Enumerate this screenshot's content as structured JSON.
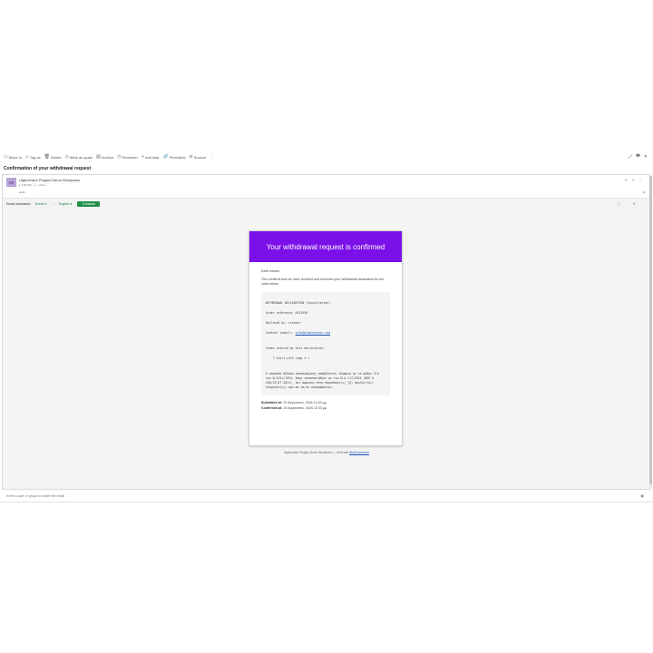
{
  "toolbar": {
    "items": [
      {
        "icon": "▭",
        "label": "Move to"
      },
      {
        "icon": "◇",
        "label": "Tag as"
      },
      {
        "icon": "🗑",
        "label": "Delete"
      },
      {
        "icon": "⚠",
        "label": "Mark as spam"
      },
      {
        "icon": "▤",
        "label": "Archive"
      },
      {
        "icon": "◷",
        "label": "Reminder"
      },
      {
        "icon": "+",
        "label": "Add task"
      },
      {
        "icon": "🔗",
        "label": "Permalink"
      },
      {
        "icon": "⊖",
        "label": "Snooze"
      },
      {
        "icon": "⋮",
        "label": ""
      }
    ],
    "right_icons": [
      "⤢",
      "🖶",
      "✕"
    ]
  },
  "subject": "Confirmation of your withdrawal request",
  "message": {
    "avatar_initials": "GP",
    "sender": "Ulgenerator Plugins Demo Wordpress",
    "meta": "▸ 4:06 PM  •  ⓘ  •  Inbox",
    "to": "Hello",
    "head_icons": "↰ ↰ ⋮",
    "head_icon_small": "⇲"
  },
  "translation": {
    "label": "Email translation",
    "from_lang": "Greek ▾",
    "arrow": "→",
    "to_lang": "English ▾",
    "button": "Translate",
    "icons": "ⓘ ✕"
  },
  "email": {
    "header": "Your withdrawal request is confirmed",
    "greeting": "Dear creator,",
    "intro": "This confirms that we have received and recorded your withdrawal declaration for the order below.",
    "decl_title": "WITHDRAWAL DECLARATION (Cancellation)",
    "order_ref": "Order reference: #123456",
    "declared_by": "Declared by: creator",
    "contact_label": "Contact (email):",
    "contact_email": "info@ulgenerator.com",
    "items_label": "Items covered by this declaration:",
    "item_1": "- T-Shirt with Logo x 1",
    "greek_text": "Η παρούσα δήλωση υπαναχώρησης υποβάλλεται σύμφωνα με το άρθρο 3ία του Ν.2251/1994, όπως τροποποιήθηκε με την Ν.Δ.117/2024 (ΦΕΚ Α 200/18.07.2024), και αφορούν στην παραπάνω(ες) [ή] προϊόν(τα)/υπηρεσία(ες) αρτικά τα/τα αναγράφονται.",
    "submitted_label": "Submitted at:",
    "submitted_value": "19 Αυγούστου, 2026 12:32 μμ",
    "confirmed_label": "Confirmed at:",
    "confirmed_value": "19 Αυγούστου, 2026 12:33 μμ",
    "footer_text": "Ulgenerator Plugins Demo Wordpress — Built with",
    "footer_link": "WooCommerce"
  },
  "share": {
    "placeholder": "Invite a user or group to share this email",
    "icon": "▣"
  }
}
